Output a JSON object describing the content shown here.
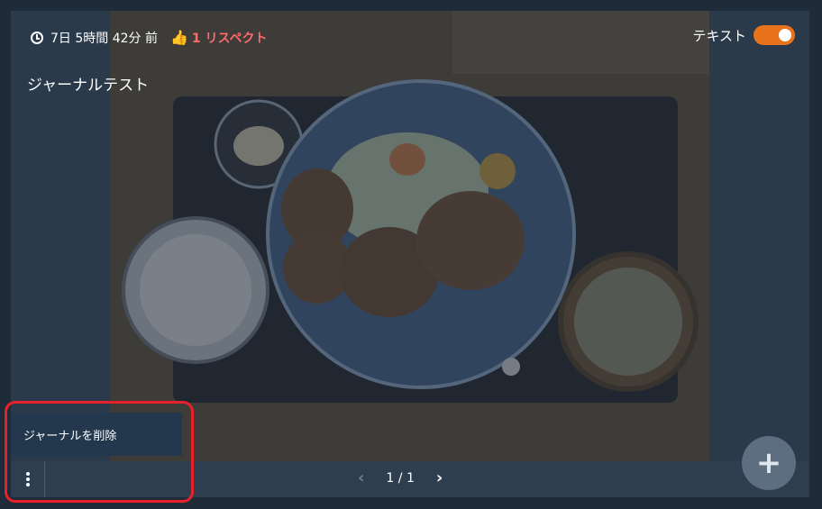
{
  "meta": {
    "time_ago": "7日 5時間 42分 前",
    "respect": "1 リスペクト"
  },
  "journal": {
    "title": "ジャーナルテスト"
  },
  "toggle": {
    "label": "テキスト",
    "on": true
  },
  "menu": {
    "delete_label": "ジャーナルを削除"
  },
  "pager": {
    "text": "1 / 1"
  },
  "icons": {
    "clock": "clock-icon",
    "thumb": "thumbs-up-icon",
    "more": "more-vertical-icon",
    "prev": "chevron-left-icon",
    "next": "chevron-right-icon",
    "add": "plus-icon"
  },
  "colors": {
    "accent": "#e8731c",
    "respect": "#ff6a6a",
    "highlight": "#e8202a"
  }
}
